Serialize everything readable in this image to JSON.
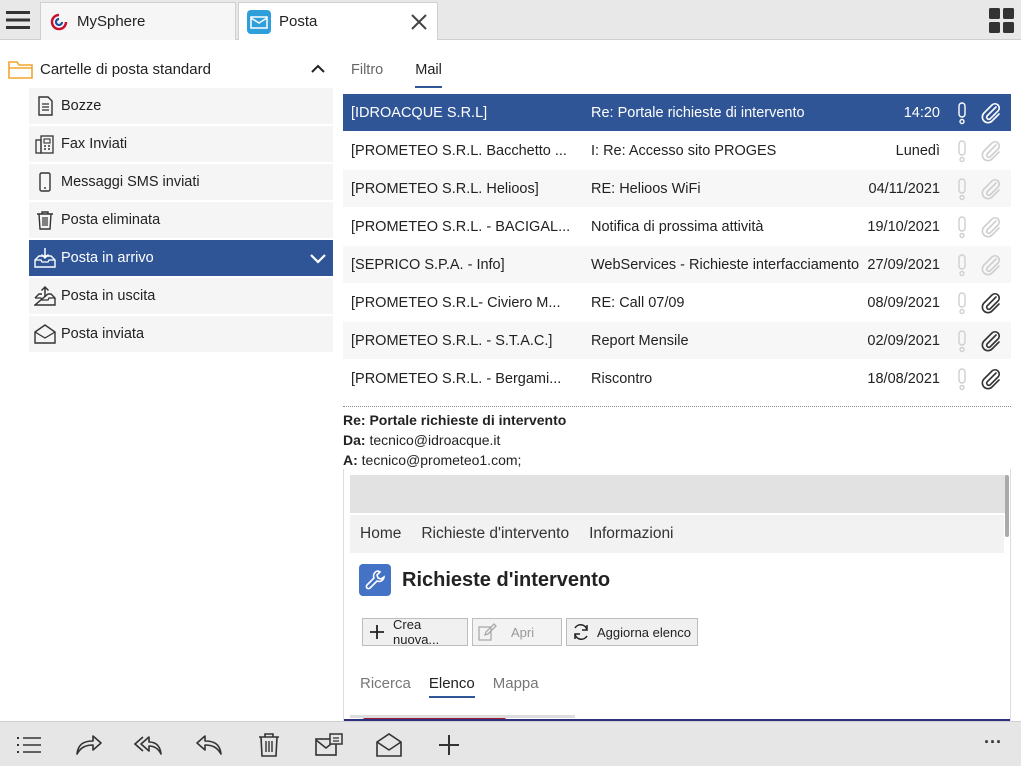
{
  "window": {
    "menu_icon": "hamburger-icon",
    "tabs": [
      {
        "label": "MySphere",
        "icon": "mysphere-logo-icon"
      },
      {
        "label": "Posta",
        "icon": "mail-app-icon",
        "active": true,
        "close_icon": "close-icon"
      }
    ],
    "layout_icon": "grid-layout-icon"
  },
  "sidebar": {
    "group_label": "Cartelle di posta standard",
    "items": [
      {
        "label": "Bozze",
        "icon": "draft-document-icon"
      },
      {
        "label": "Fax Inviati",
        "icon": "fax-icon"
      },
      {
        "label": "Messaggi SMS inviati",
        "icon": "phone-icon"
      },
      {
        "label": "Posta eliminata",
        "icon": "trash-icon"
      },
      {
        "label": "Posta in arrivo",
        "icon": "inbox-icon",
        "active": true
      },
      {
        "label": "Posta in uscita",
        "icon": "outbox-icon"
      },
      {
        "label": "Posta inviata",
        "icon": "sent-mail-icon"
      }
    ]
  },
  "main": {
    "tabs": [
      {
        "label": "Filtro"
      },
      {
        "label": "Mail",
        "active": true
      }
    ],
    "messages": [
      {
        "from": "[IDROACQUE S.R.L]",
        "subject": "Re: Portale richieste di intervento",
        "date": "14:20",
        "attachment": true,
        "selected": true
      },
      {
        "from": "[PROMETEO S.R.L. Bacchetto ...",
        "subject": "I: Re: Accesso sito PROGES",
        "date": "Lunedì",
        "attachment": false
      },
      {
        "from": "[PROMETEO S.R.L. Helioos]",
        "subject": "RE: Helioos WiFi",
        "date": "04/11/2021",
        "attachment": false
      },
      {
        "from": "[PROMETEO S.R.L. - BACIGAL...",
        "subject": "Notifica di prossima attività",
        "date": "19/10/2021",
        "attachment": false
      },
      {
        "from": "[SEPRICO S.P.A. - Info]",
        "subject": "WebServices - Richieste interfacciamento",
        "date": "27/09/2021",
        "attachment": false
      },
      {
        "from": "[PROMETEO S.R.L- Civiero M...",
        "subject": "RE: Call 07/09",
        "date": "08/09/2021",
        "attachment": true
      },
      {
        "from": "[PROMETEO S.R.L. - S.T.A.C.]",
        "subject": "Report Mensile",
        "date": "02/09/2021",
        "attachment": true
      },
      {
        "from": "[PROMETEO S.R.L. - Bergami...",
        "subject": "Riscontro",
        "date": "18/08/2021",
        "attachment": true
      }
    ],
    "preview": {
      "subject": "Re: Portale richieste di intervento",
      "from_label": "Da:",
      "from": "tecnico@idroacque.it",
      "to_label": "A:",
      "to": "tecnico@prometeo1.com;",
      "embedded": {
        "nav": [
          "Home",
          "Richieste d'intervento",
          "Informazioni"
        ],
        "title": "Richieste d'intervento",
        "buttons": [
          {
            "label": "Crea nuova...",
            "icon": "plus-icon"
          },
          {
            "label": "Apri",
            "icon": "edit-icon",
            "disabled": true
          },
          {
            "label": "Aggiorna elenco",
            "icon": "refresh-icon"
          }
        ],
        "tabs": [
          {
            "label": "Ricerca"
          },
          {
            "label": "Elenco",
            "active": true
          },
          {
            "label": "Mappa"
          }
        ]
      }
    }
  },
  "toolbar": {
    "icons": [
      "list-icon",
      "forward-icon",
      "reply-all-icon",
      "reply-icon",
      "trash-icon",
      "mail-new-icon",
      "mark-read-icon",
      "add-icon",
      "more-icon"
    ],
    "more_label": "···"
  },
  "colors": {
    "accent": "#2f5597",
    "folder": "#f2a531",
    "tab_icon_bg": "#2e9fdb"
  }
}
